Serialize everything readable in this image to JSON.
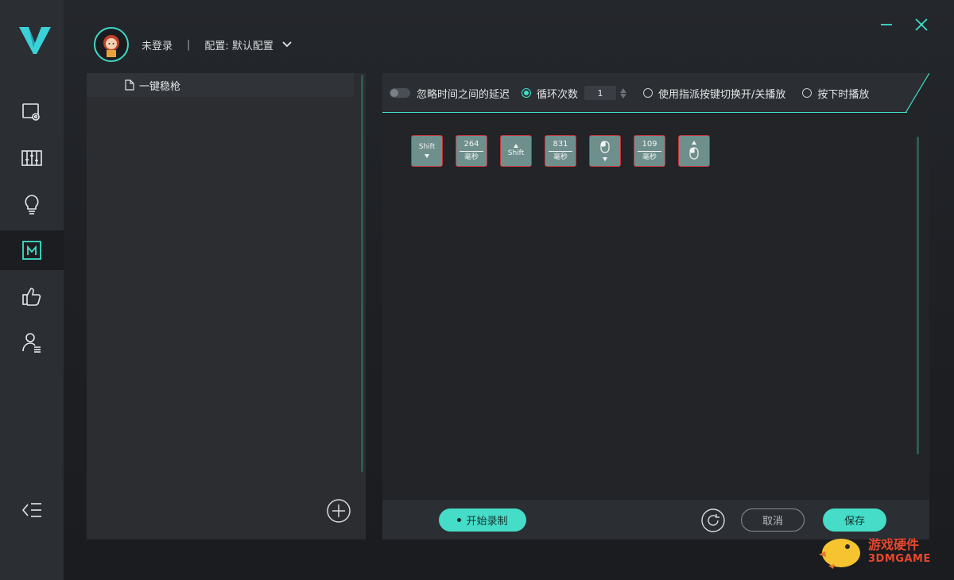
{
  "colors": {
    "accent": "#45dcc8",
    "key_fill": "#6e8f8c",
    "key_border": "#c4343a",
    "sidebar": "#2b2e33"
  },
  "sidebar": {
    "logo": "v-logo",
    "items": [
      {
        "icon": "monitor-settings-icon",
        "active": false
      },
      {
        "icon": "equalizer-icon",
        "active": false
      },
      {
        "icon": "lightbulb-icon",
        "active": false
      },
      {
        "icon": "macro-icon",
        "active": true
      },
      {
        "icon": "thumbs-up-icon",
        "active": false
      },
      {
        "icon": "user-list-icon",
        "active": false
      }
    ],
    "collapse_icon": "collapse-menu-icon"
  },
  "header": {
    "login_status": "未登录",
    "separator": "|",
    "profile_label": "配置: 默认配置"
  },
  "macro_list": {
    "items": [
      {
        "name": "一键稳枪"
      }
    ]
  },
  "options": {
    "ignore_delay": "忽略时间之间的延迟",
    "loop_count_label": "循环次数",
    "loop_count_value": "1",
    "toggle_playback": "使用指派按键切换开/关播放",
    "press_playback": "按下时播放"
  },
  "sequence": [
    {
      "type": "key",
      "label": "Shift",
      "action": "down"
    },
    {
      "type": "delay",
      "value": "264",
      "unit": "毫秒"
    },
    {
      "type": "key",
      "label": "Shift",
      "action": "up"
    },
    {
      "type": "delay",
      "value": "831",
      "unit": "毫秒"
    },
    {
      "type": "mouse",
      "action": "down"
    },
    {
      "type": "delay",
      "value": "109",
      "unit": "毫秒"
    },
    {
      "type": "mouse",
      "action": "up"
    }
  ],
  "footer": {
    "record_label": "开始录制",
    "cancel_label": "取消",
    "save_label": "保存"
  },
  "watermark": {
    "line1": "游戏硬件",
    "line2": "3DMGAME"
  }
}
